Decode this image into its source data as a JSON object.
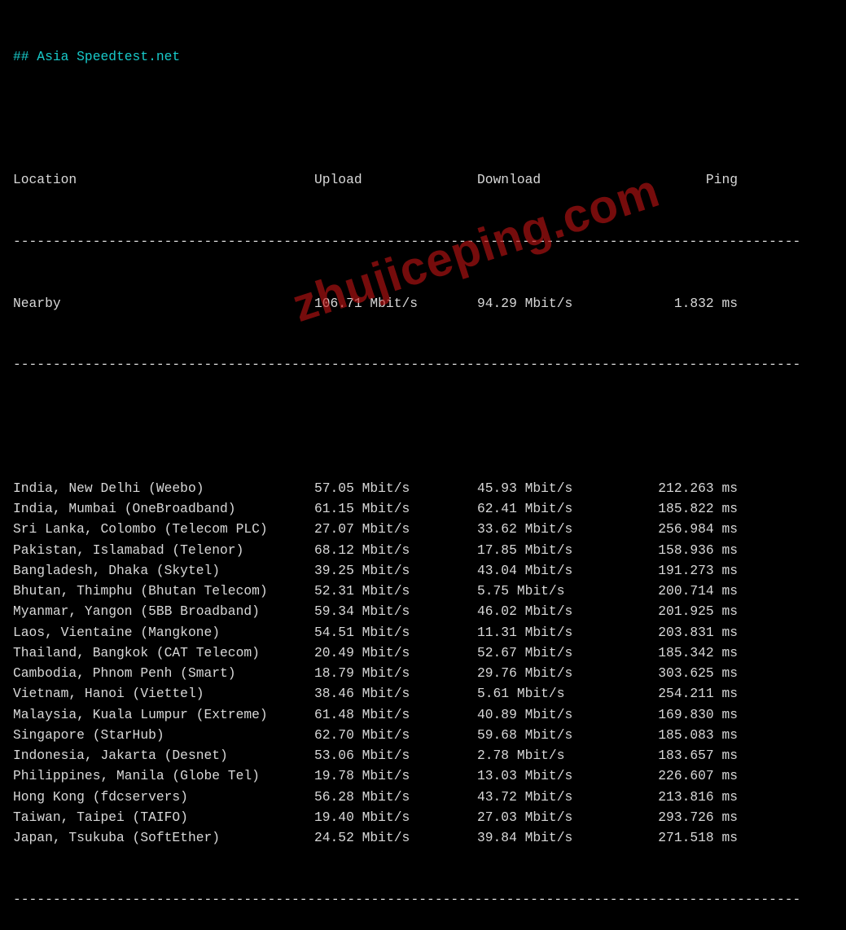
{
  "header": "## Asia Speedtest.net",
  "columns": {
    "location": "Location",
    "upload": "Upload",
    "download": "Download",
    "ping": "Ping"
  },
  "divider_top": "---------------------------------------------------------------------------------------------------",
  "divider_bottom": "---------------------------------------------------------------------------------------------------",
  "divider_footer": "---------------------------------------------------------------------------------------------------",
  "nearby": {
    "location": "Nearby",
    "upload": "106.71 Mbit/s",
    "download": "94.29 Mbit/s",
    "ping": "1.832 ms"
  },
  "rows": [
    {
      "location": "India, New Delhi (Weebo)",
      "upload": "57.05 Mbit/s",
      "download": "45.93 Mbit/s",
      "ping": "212.263 ms"
    },
    {
      "location": "India, Mumbai (OneBroadband)",
      "upload": "61.15 Mbit/s",
      "download": "62.41 Mbit/s",
      "ping": "185.822 ms"
    },
    {
      "location": "Sri Lanka, Colombo (Telecom PLC)",
      "upload": "27.07 Mbit/s",
      "download": "33.62 Mbit/s",
      "ping": "256.984 ms"
    },
    {
      "location": "Pakistan, Islamabad (Telenor)",
      "upload": "68.12 Mbit/s",
      "download": "17.85 Mbit/s",
      "ping": "158.936 ms"
    },
    {
      "location": "Bangladesh, Dhaka (Skytel)",
      "upload": "39.25 Mbit/s",
      "download": "43.04 Mbit/s",
      "ping": "191.273 ms"
    },
    {
      "location": "Bhutan, Thimphu (Bhutan Telecom)",
      "upload": "52.31 Mbit/s",
      "download": "5.75 Mbit/s",
      "ping": "200.714 ms"
    },
    {
      "location": "Myanmar, Yangon (5BB Broadband)",
      "upload": "59.34 Mbit/s",
      "download": "46.02 Mbit/s",
      "ping": "201.925 ms"
    },
    {
      "location": "Laos, Vientaine (Mangkone)",
      "upload": "54.51 Mbit/s",
      "download": "11.31 Mbit/s",
      "ping": "203.831 ms"
    },
    {
      "location": "Thailand, Bangkok (CAT Telecom)",
      "upload": "20.49 Mbit/s",
      "download": "52.67 Mbit/s",
      "ping": "185.342 ms"
    },
    {
      "location": "Cambodia, Phnom Penh (Smart)",
      "upload": "18.79 Mbit/s",
      "download": "29.76 Mbit/s",
      "ping": "303.625 ms"
    },
    {
      "location": "Vietnam, Hanoi (Viettel)",
      "upload": "38.46 Mbit/s",
      "download": "5.61 Mbit/s",
      "ping": "254.211 ms"
    },
    {
      "location": "Malaysia, Kuala Lumpur (Extreme)",
      "upload": "61.48 Mbit/s",
      "download": "40.89 Mbit/s",
      "ping": "169.830 ms"
    },
    {
      "location": "Singapore (StarHub)",
      "upload": "62.70 Mbit/s",
      "download": "59.68 Mbit/s",
      "ping": "185.083 ms"
    },
    {
      "location": "Indonesia, Jakarta (Desnet)",
      "upload": "53.06 Mbit/s",
      "download": "2.78 Mbit/s",
      "ping": "183.657 ms"
    },
    {
      "location": "Philippines, Manila (Globe Tel)",
      "upload": "19.78 Mbit/s",
      "download": "13.03 Mbit/s",
      "ping": "226.607 ms"
    },
    {
      "location": "Hong Kong (fdcservers)",
      "upload": "56.28 Mbit/s",
      "download": "43.72 Mbit/s",
      "ping": "213.816 ms"
    },
    {
      "location": "Taiwan, Taipei (TAIFO)",
      "upload": "19.40 Mbit/s",
      "download": "27.03 Mbit/s",
      "ping": "293.726 ms"
    },
    {
      "location": "Japan, Tsukuba (SoftEther)",
      "upload": "24.52 Mbit/s",
      "download": "39.84 Mbit/s",
      "ping": "271.518 ms"
    }
  ],
  "watermark": "zhujiceping.com",
  "chart_data": {
    "type": "table",
    "title": "Asia Speedtest.net",
    "columns": [
      "Location",
      "Upload (Mbit/s)",
      "Download (Mbit/s)",
      "Ping (ms)"
    ],
    "rows": [
      [
        "Nearby",
        106.71,
        94.29,
        1.832
      ],
      [
        "India, New Delhi (Weebo)",
        57.05,
        45.93,
        212.263
      ],
      [
        "India, Mumbai (OneBroadband)",
        61.15,
        62.41,
        185.822
      ],
      [
        "Sri Lanka, Colombo (Telecom PLC)",
        27.07,
        33.62,
        256.984
      ],
      [
        "Pakistan, Islamabad (Telenor)",
        68.12,
        17.85,
        158.936
      ],
      [
        "Bangladesh, Dhaka (Skytel)",
        39.25,
        43.04,
        191.273
      ],
      [
        "Bhutan, Thimphu (Bhutan Telecom)",
        52.31,
        5.75,
        200.714
      ],
      [
        "Myanmar, Yangon (5BB Broadband)",
        59.34,
        46.02,
        201.925
      ],
      [
        "Laos, Vientaine (Mangkone)",
        54.51,
        11.31,
        203.831
      ],
      [
        "Thailand, Bangkok (CAT Telecom)",
        20.49,
        52.67,
        185.342
      ],
      [
        "Cambodia, Phnom Penh (Smart)",
        18.79,
        29.76,
        303.625
      ],
      [
        "Vietnam, Hanoi (Viettel)",
        38.46,
        5.61,
        254.211
      ],
      [
        "Malaysia, Kuala Lumpur (Extreme)",
        61.48,
        40.89,
        169.83
      ],
      [
        "Singapore (StarHub)",
        62.7,
        59.68,
        185.083
      ],
      [
        "Indonesia, Jakarta (Desnet)",
        53.06,
        2.78,
        183.657
      ],
      [
        "Philippines, Manila (Globe Tel)",
        19.78,
        13.03,
        226.607
      ],
      [
        "Hong Kong (fdcservers)",
        56.28,
        43.72,
        213.816
      ],
      [
        "Taiwan, Taipei (TAIFO)",
        19.4,
        27.03,
        293.726
      ],
      [
        "Japan, Tsukuba (SoftEther)",
        24.52,
        39.84,
        271.518
      ]
    ]
  }
}
